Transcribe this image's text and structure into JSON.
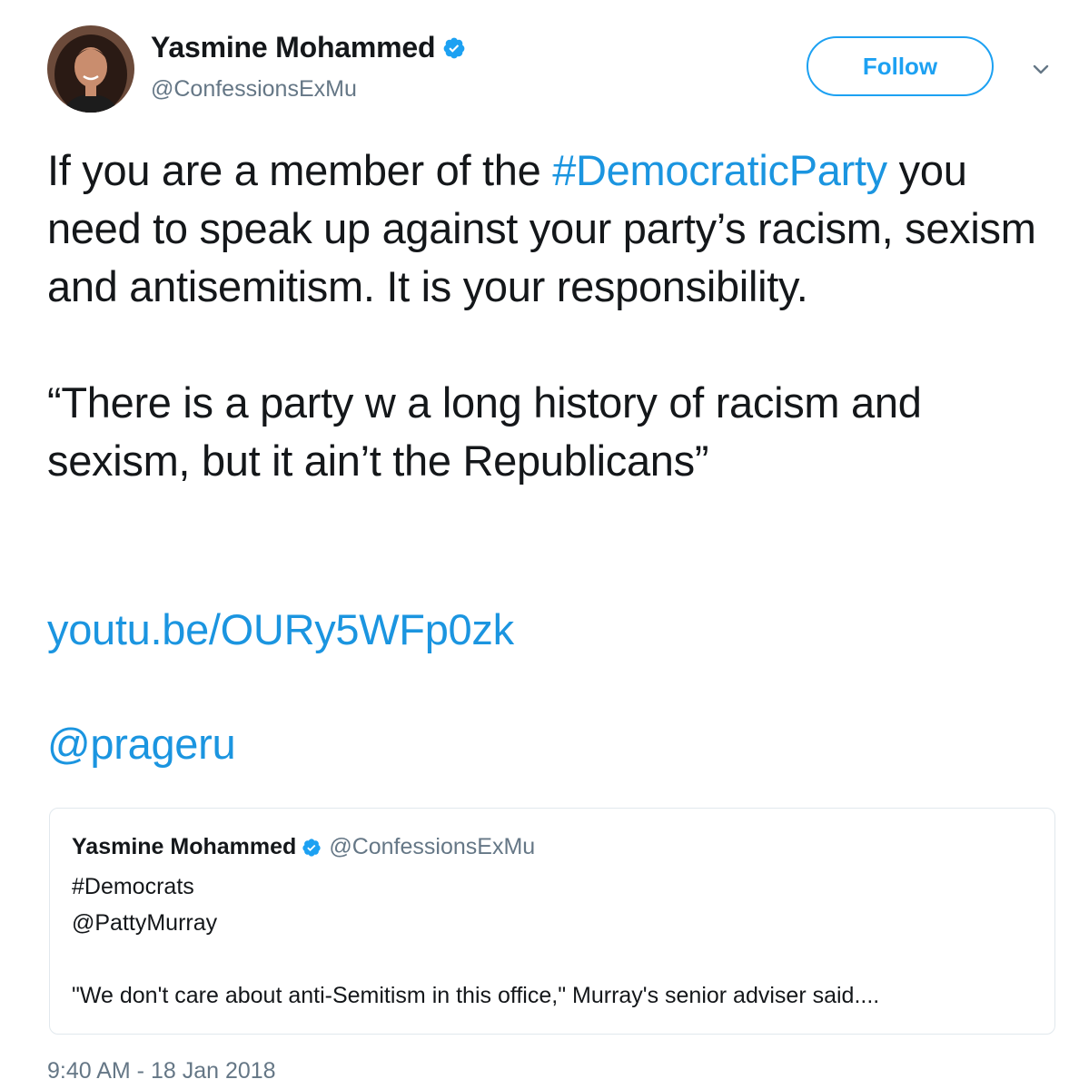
{
  "author": {
    "display_name": "Yasmine Mohammed",
    "handle": "@ConfessionsExMu",
    "verified_icon": "verified-badge-icon",
    "avatar": "profile-photo"
  },
  "header": {
    "follow_label": "Follow",
    "menu_icon": "chevron-down-icon"
  },
  "tweet": {
    "line1_prefix": "If you are a member of the ",
    "hashtag": "#DemocraticParty",
    "line1_rest": " you need to speak up against your party’s racism, sexism and antisemitism. It is your responsibility.",
    "quote_text": "“There is a party w a long history of racism and sexism, but it ain’t the Republicans”",
    "link": "youtu.be/OURy5WFp0zk",
    "mention": "@prageru"
  },
  "quoted_tweet": {
    "display_name": "Yasmine Mohammed",
    "handle": "@ConfessionsExMu",
    "line1": "#Democrats",
    "line2": "@PattyMurray",
    "line3": "\"We don't care about anti-Semitism in this office,\" Murray's senior adviser said...."
  },
  "timestamp": "9:40 AM - 18 Jan 2018",
  "colors": {
    "accent": "#1da1f2",
    "link": "#1b95e0",
    "secondary_text": "#657786",
    "border": "#e1e8ed"
  }
}
